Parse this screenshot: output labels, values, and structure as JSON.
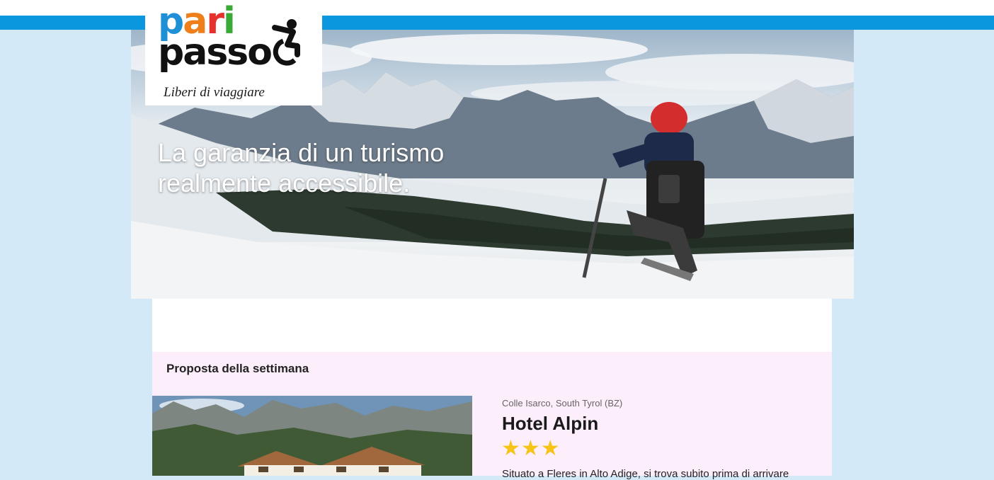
{
  "logo": {
    "word_top": "pari",
    "word_bottom": "passo",
    "tagline": "Liberi di viaggiare",
    "colors": {
      "p": "#1f8fd6",
      "a": "#ef7f1a",
      "r": "#e5322d",
      "i": "#3aa935",
      "bottom": "#111111"
    },
    "icon": "wheelchair-icon"
  },
  "hero": {
    "title": "La garanzia di un turismo realmente accessibile.",
    "image": "sit-ski-mountain-image"
  },
  "proposal": {
    "heading": "Proposta della settimana",
    "hotel": {
      "location": "Colle Isarco, South Tyrol (BZ)",
      "name": "Hotel Alpin",
      "stars": "★★★",
      "star_count": 3,
      "description": "Situato a Fleres in Alto Adige, si trova subito prima di arrivare",
      "image": "hotel-mountain-image"
    }
  },
  "colors": {
    "page_background": "#d4e9f7",
    "top_bar": "#0a97dd",
    "proposal_background": "#fdeefb",
    "stars": "#f5c417"
  }
}
